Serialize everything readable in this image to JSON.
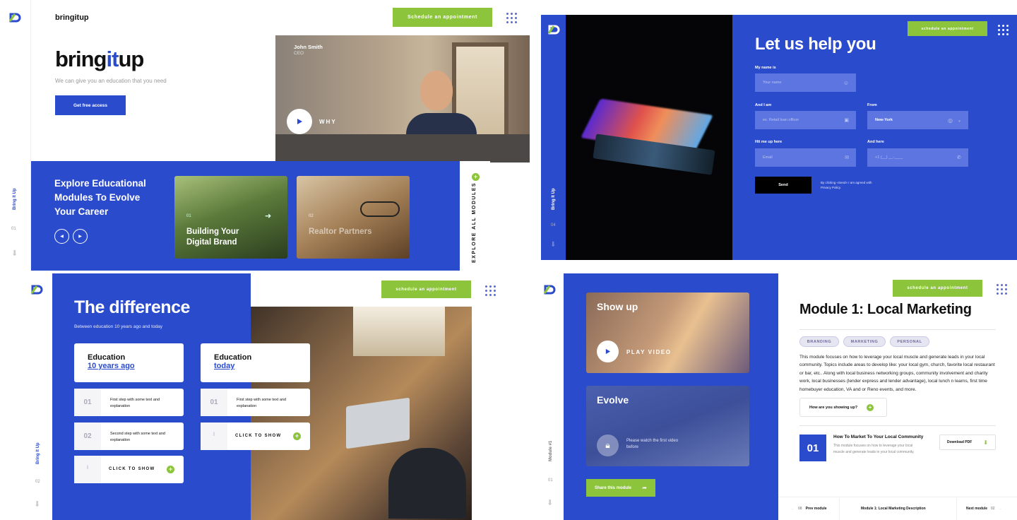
{
  "q1": {
    "brand": "bringitup",
    "schedule_label": "Schedule an appointment",
    "hero_title_a": "bring",
    "hero_title_b": "it",
    "hero_title_c": "up",
    "subtitle": "We can give you an education that you need",
    "cta_label": "Get free access",
    "person_name": "John Smith",
    "person_role": "CEO",
    "why_label": "WHY",
    "explore_title": "Explore Educational Modules To Evolve Your Career",
    "cards": [
      {
        "num": "01",
        "title": "Building Your Digital Brand"
      },
      {
        "num": "02",
        "title": "Realtor Partners"
      }
    ],
    "explore_all": "EXPLORE ALL MODULES",
    "side_label": "Bring It Up",
    "page_num": "01"
  },
  "q2": {
    "schedule_label": "schedule an appointment",
    "title": "Let us help you",
    "name_label": "My name is",
    "name_placeholder": "Your name",
    "iam_label": "And I am",
    "iam_placeholder": "ex. Retail loan officer",
    "from_label": "From",
    "from_value": "New-York",
    "hit_label": "Hit me up here",
    "email_placeholder": "Email",
    "andhere_label": "And here",
    "phone_placeholder": "+1 (__) __-____",
    "send_label": "Send",
    "agree_text": "By clicking «Send» I am agreed with Privacy Policy.",
    "side_label": "Bring It Up",
    "page_num": "04"
  },
  "q3": {
    "schedule_label": "schedule an appointment",
    "title": "The difference",
    "subtitle": "Between education 10 years ago and today",
    "col_a_title": "Education",
    "col_a_sub": "10 years ago",
    "col_b_title": "Education",
    "col_b_sub": "today",
    "steps_a": [
      {
        "num": "01",
        "text": "First step with some text and explanation"
      },
      {
        "num": "02",
        "text": "Second step with some text and explanation"
      }
    ],
    "steps_b": [
      {
        "num": "01",
        "text": "First step with some text and explanation"
      }
    ],
    "click_label": "CLICK TO SHOW",
    "side_label": "Bring It Up",
    "page_num": "02"
  },
  "q4": {
    "schedule_label": "schedule an appointment",
    "video1_title": "Show up",
    "play_label": "PLAY VIDEO",
    "video2_title": "Evolve",
    "locked_text": "Please watch the first video before",
    "share_label": "Share this module",
    "title": "Module 1: Local Marketing",
    "tags": [
      "BRANDING",
      "MARKETING",
      "PERSONAL"
    ],
    "description": "This module focuses on how to leverage your local muscle and generate leads in your local community. Topics include areas to develop like: your local gym, church, favorite local restaurant or bar, etc.. Along with local business networking groups, community involvement and charity work, local businesses (lender express and lender advantage), local lunch n learns, first time homebuyer education, VA and or Reno events, and more.",
    "question": "How are you showing up?",
    "lesson_num": "01",
    "lesson_title": "How To Market To Your Local Community",
    "lesson_text": "This module focuses on how to leverage your local muscle and generate leads in your local community.",
    "download_label": "Download PDF",
    "prev_num": "08",
    "prev_label": "Prev module",
    "current_label": "Module 1: Local Marketing Description",
    "next_label": "Next module",
    "next_num": "02",
    "side_label": "Module #1",
    "page_num": "01"
  },
  "colors": {
    "brand_blue": "#2b4bcd",
    "accent_green": "#8cc43c"
  }
}
